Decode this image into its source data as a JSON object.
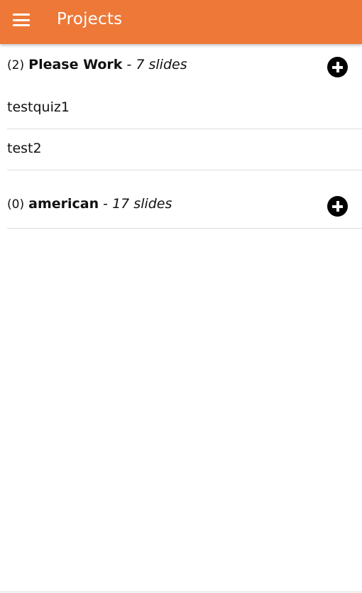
{
  "appbar": {
    "title": "Projects",
    "menu_icon": "hamburger-menu-icon"
  },
  "groups": [
    {
      "count": "(2)",
      "name": "Please Work",
      "separator": " - ",
      "slides": "7 slides",
      "add_icon": "add-circle-icon",
      "items": [
        "testquiz1",
        "test2"
      ]
    },
    {
      "count": "(0)",
      "name": "american",
      "separator": " - ",
      "slides": "17 slides",
      "add_icon": "add-circle-icon",
      "items": []
    }
  ],
  "colors": {
    "appbar": "#ee7838",
    "divider": "#dddddd"
  }
}
